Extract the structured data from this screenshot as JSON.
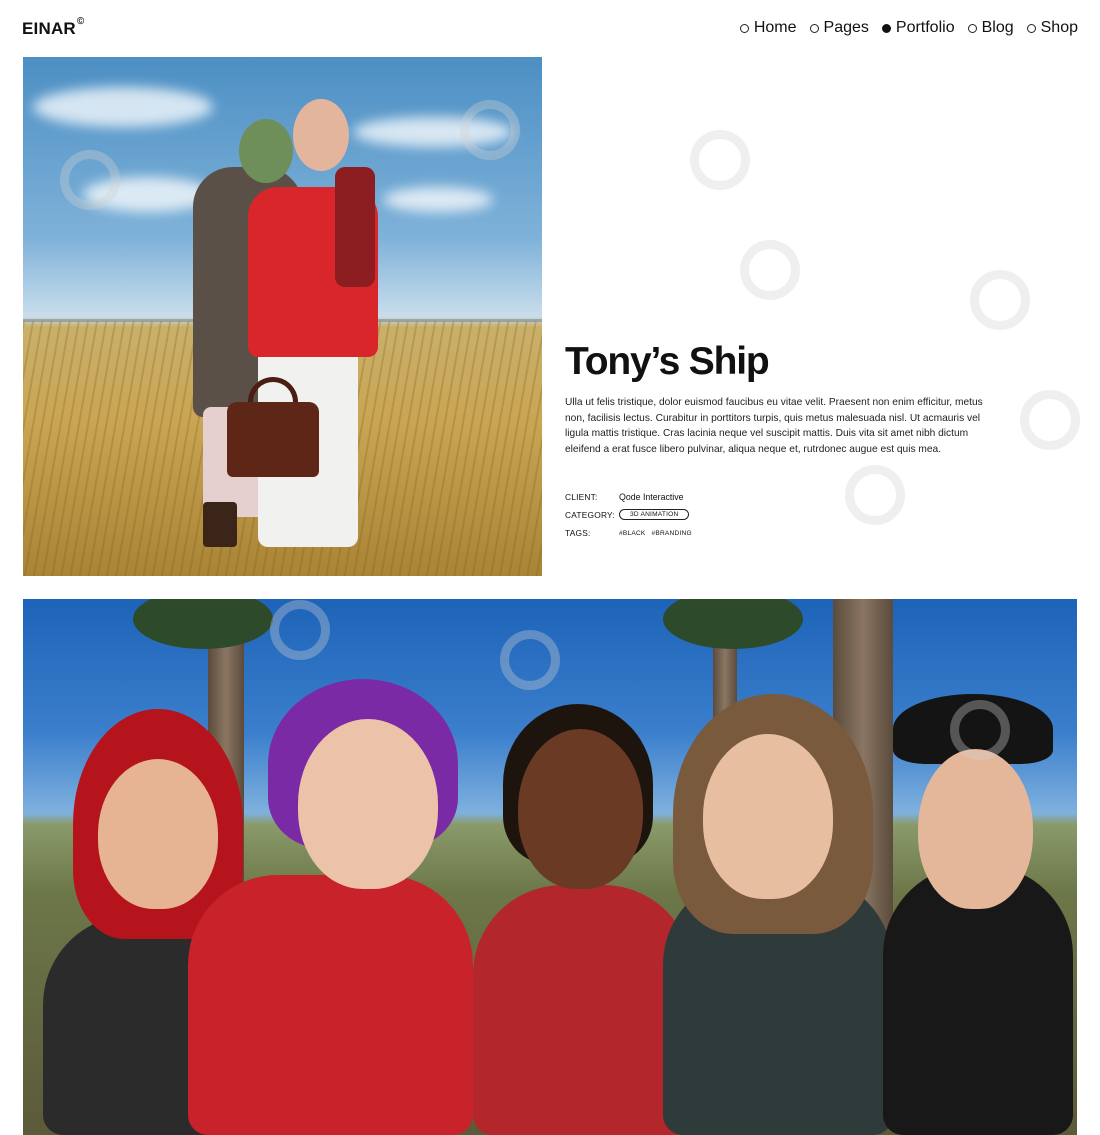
{
  "header": {
    "logo": "EINAR",
    "logo_mark": "©",
    "nav": [
      {
        "label": "Home",
        "active": false
      },
      {
        "label": "Pages",
        "active": false
      },
      {
        "label": "Portfolio",
        "active": true
      },
      {
        "label": "Blog",
        "active": false
      },
      {
        "label": "Shop",
        "active": false
      }
    ]
  },
  "project": {
    "title": "Tony’s Ship",
    "description": "Ulla ut felis tristique, dolor euismod faucibus eu vitae velit. Praesent non enim efficitur, metus non, facilisis lectus. Curabitur in porttitors turpis, quis metus malesuada nisl. Ut acmauris vel ligula mattis tristique. Cras lacinia neque vel suscipit mattis. Duis vita sit amet nibh dictum eleifend a erat fusce libero pulvinar, aliqua neque et, rutrdonec augue est quis mea.",
    "client_label": "CLIENT:",
    "client_value": "Qode Interactive",
    "category_label": "CATEGORY:",
    "category_value": "3D ANIMATION",
    "tags_label": "TAGS:",
    "tags": [
      "#BLACK",
      "#BRANDING"
    ]
  },
  "colors": {
    "accent": "#111111",
    "background": "#ffffff"
  }
}
